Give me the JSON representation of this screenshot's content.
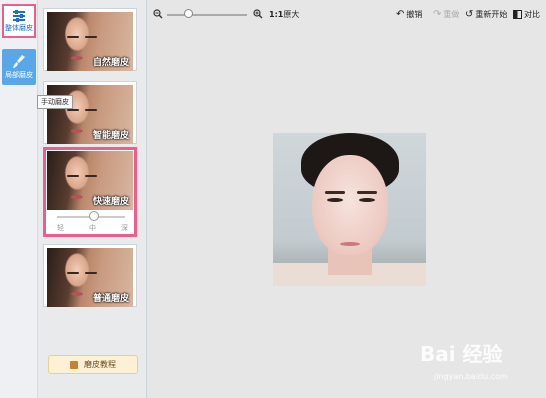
{
  "tabs": [
    {
      "label": "整体磨皮",
      "icon": "sliders-icon"
    },
    {
      "label": "局部磨皮",
      "icon": "brush-icon"
    }
  ],
  "tooltip": "手动磨皮",
  "effects": [
    {
      "label": "自然磨皮"
    },
    {
      "label": "智能磨皮"
    },
    {
      "label": "快速磨皮"
    },
    {
      "label": "普通磨皮"
    }
  ],
  "intensity": {
    "low": "轻",
    "mid": "中",
    "high": "深",
    "level": 0.5
  },
  "tutorial_button": "磨皮教程",
  "toolbar": {
    "zoom_out_icon": "zoom-out-icon",
    "zoom_in_icon": "zoom-in-icon",
    "original_size": "原大",
    "original_ratio": "1:1",
    "undo": "撤销",
    "redo": "重做",
    "restart": "重新开始",
    "compare": "对比"
  },
  "watermark": {
    "brand": "Bai 经验",
    "url": "jingyan.baidu.com"
  },
  "colors": {
    "highlight": "#ec5f8d",
    "accent": "#59a6e9",
    "tab_text": "#1b6fd0"
  }
}
